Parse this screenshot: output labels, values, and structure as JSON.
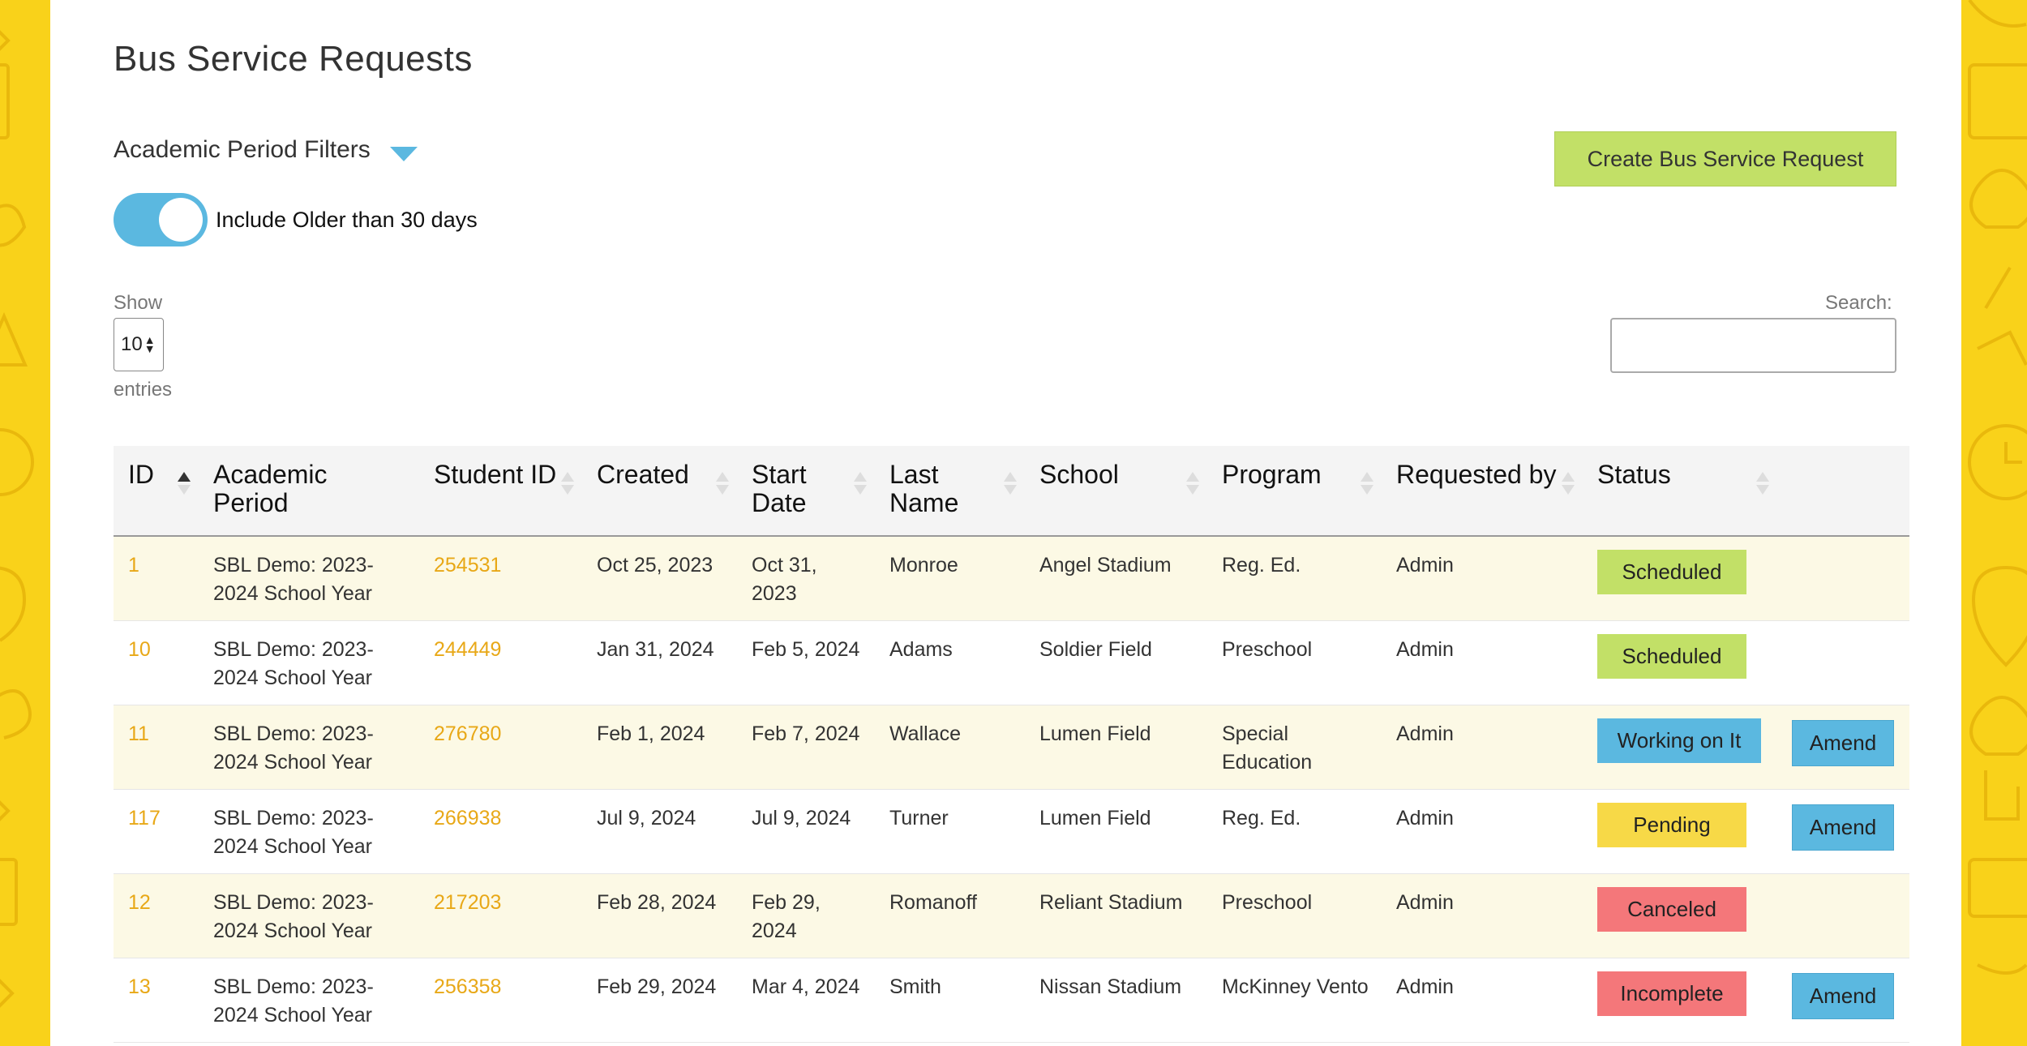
{
  "page": {
    "title": "Bus Service Requests"
  },
  "filters": {
    "label": "Academic Period Filters"
  },
  "toggle": {
    "label": "Include Older than 30 days",
    "on": true
  },
  "actions": {
    "create_label": "Create Bus Service Request"
  },
  "length": {
    "show_label": "Show",
    "value": "10",
    "entries_label": "entries"
  },
  "search": {
    "label": "Search:",
    "value": ""
  },
  "colors": {
    "scheduled": "#c2e067",
    "working": "#5bb8e0",
    "pending": "#f7d947",
    "canceled": "#f4777a",
    "incomplete": "#f4777a",
    "link": "#e8a817",
    "accent": "#5bb8e0"
  },
  "table": {
    "headers": [
      "ID",
      "Academic Period",
      "Student ID",
      "Created",
      "Start Date",
      "Last Name",
      "School",
      "Program",
      "Requested by",
      "Status",
      ""
    ],
    "sort_column": "ID",
    "sort_direction": "ascending",
    "rows": [
      {
        "id": "1",
        "period": "SBL Demo: 2023-2024 School Year",
        "student_id": "254531",
        "created": "Oct 25, 2023",
        "start": "Oct 31, 2023",
        "last_name": "Monroe",
        "school": "Angel Stadium",
        "program": "Reg. Ed.",
        "requested_by": "Admin",
        "status": "Scheduled",
        "action": ""
      },
      {
        "id": "10",
        "period": "SBL Demo: 2023-2024 School Year",
        "student_id": "244449",
        "created": "Jan 31, 2024",
        "start": "Feb 5, 2024",
        "last_name": "Adams",
        "school": "Soldier Field",
        "program": "Preschool",
        "requested_by": "Admin",
        "status": "Scheduled",
        "action": ""
      },
      {
        "id": "11",
        "period": "SBL Demo: 2023-2024 School Year",
        "student_id": "276780",
        "created": "Feb 1, 2024",
        "start": "Feb 7, 2024",
        "last_name": "Wallace",
        "school": "Lumen Field",
        "program": "Special Education",
        "requested_by": "Admin",
        "status": "Working on It",
        "action": "Amend"
      },
      {
        "id": "117",
        "period": "SBL Demo: 2023-2024 School Year",
        "student_id": "266938",
        "created": "Jul 9, 2024",
        "start": "Jul 9, 2024",
        "last_name": "Turner",
        "school": "Lumen Field",
        "program": "Reg. Ed.",
        "requested_by": "Admin",
        "status": "Pending",
        "action": "Amend"
      },
      {
        "id": "12",
        "period": "SBL Demo: 2023-2024 School Year",
        "student_id": "217203",
        "created": "Feb 28, 2024",
        "start": "Feb 29, 2024",
        "last_name": "Romanoff",
        "school": "Reliant Stadium",
        "program": "Preschool",
        "requested_by": "Admin",
        "status": "Canceled",
        "action": ""
      },
      {
        "id": "13",
        "period": "SBL Demo: 2023-2024 School Year",
        "student_id": "256358",
        "created": "Feb 29, 2024",
        "start": "Mar 4, 2024",
        "last_name": "Smith",
        "school": "Nissan Stadium",
        "program": "McKinney Vento",
        "requested_by": "Admin",
        "status": "Incomplete",
        "action": "Amend"
      }
    ]
  }
}
